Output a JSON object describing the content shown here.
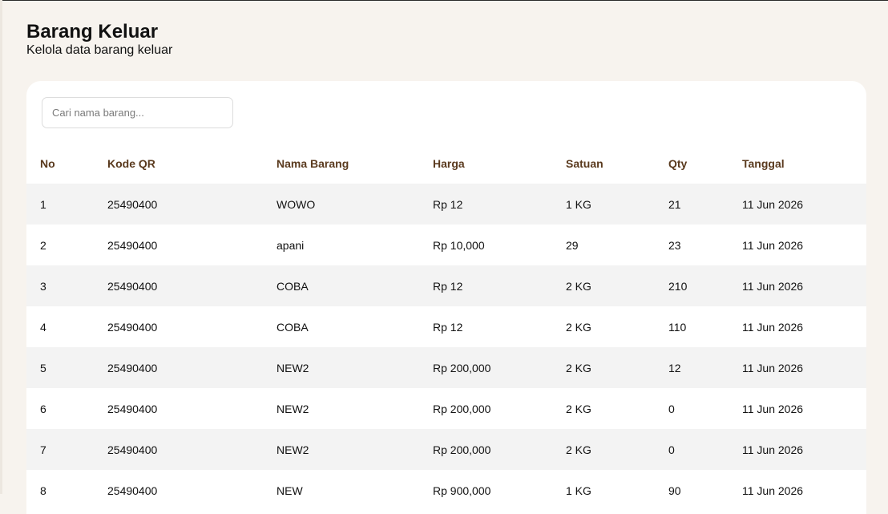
{
  "page": {
    "title": "Barang Keluar",
    "subtitle": "Kelola data barang keluar"
  },
  "search": {
    "placeholder": "Cari nama barang...",
    "value": ""
  },
  "table": {
    "headers": [
      "No",
      "Kode QR",
      "Nama Barang",
      "Harga",
      "Satuan",
      "Qty",
      "Tanggal"
    ],
    "rows": [
      [
        "1",
        "25490400",
        "WOWO",
        "Rp 12",
        "1 KG",
        "21",
        "11 Jun 2026"
      ],
      [
        "2",
        "25490400",
        "apani",
        "Rp 10,000",
        "29",
        "23",
        "11 Jun 2026"
      ],
      [
        "3",
        "25490400",
        "COBA",
        "Rp 12",
        "2 KG",
        "210",
        "11 Jun 2026"
      ],
      [
        "4",
        "25490400",
        "COBA",
        "Rp 12",
        "2 KG",
        "110",
        "11 Jun 2026"
      ],
      [
        "5",
        "25490400",
        "NEW2",
        "Rp 200,000",
        "2 KG",
        "12",
        "11 Jun 2026"
      ],
      [
        "6",
        "25490400",
        "NEW2",
        "Rp 200,000",
        "2 KG",
        "0",
        "11 Jun 2026"
      ],
      [
        "7",
        "25490400",
        "NEW2",
        "Rp 200,000",
        "2 KG",
        "0",
        "11 Jun 2026"
      ],
      [
        "8",
        "25490400",
        "NEW",
        "Rp 900,000",
        "1 KG",
        "90",
        "11 Jun 2026"
      ]
    ]
  },
  "colors": {
    "background": "#f7f3ee",
    "header_text": "#5a3a1e",
    "row_alt": "#f3f3f3",
    "card": "#ffffff"
  }
}
